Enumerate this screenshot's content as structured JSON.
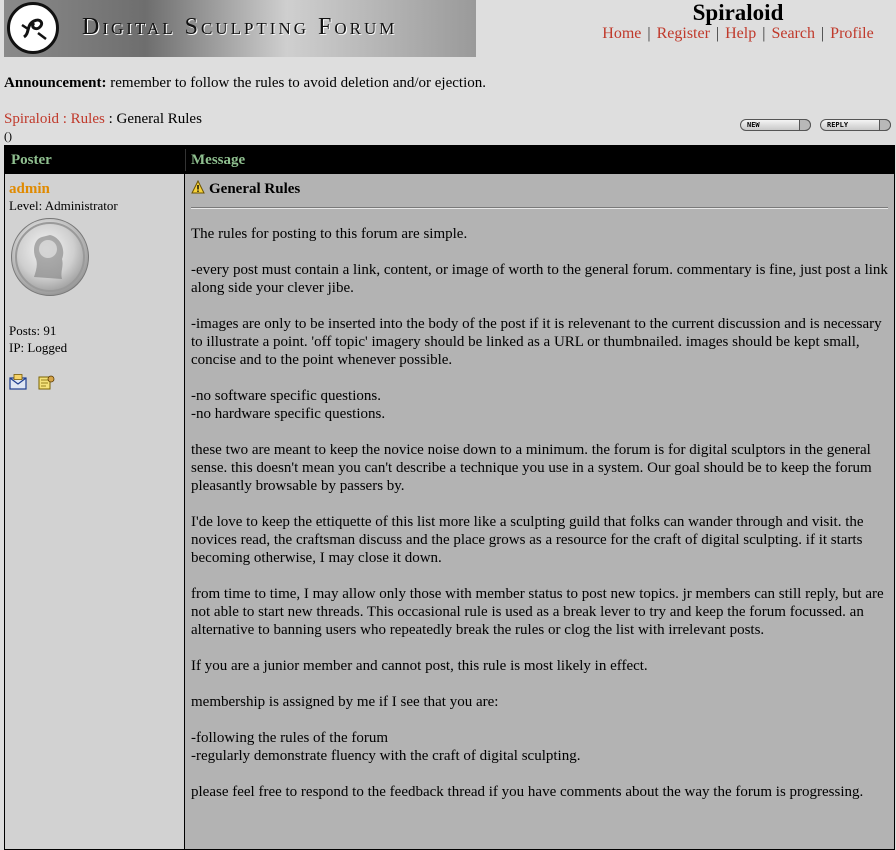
{
  "site": {
    "banner_title": "Digital Sculpting Forum",
    "title": "Spiraloid"
  },
  "nav": {
    "home": "Home",
    "register": "Register",
    "help": "Help",
    "search": "Search",
    "profile": "Profile",
    "separator": "|"
  },
  "announcement": {
    "label": "Announcement:",
    "text": "remember to follow the rules to avoid deletion and/or ejection."
  },
  "breadcrumb": {
    "root": "Spiraloid",
    "sep": ":",
    "forum": "Rules",
    "current": "General Rules"
  },
  "paren": "()",
  "buttons": {
    "new": "NEW",
    "reply": "REPLY"
  },
  "table": {
    "col_poster": "Poster",
    "col_message": "Message"
  },
  "post": {
    "author": "admin",
    "level": "Level: Administrator",
    "posts": "Posts: 91",
    "ip": "IP: Logged",
    "title": "General Rules",
    "paragraphs": [
      "The rules for posting to this forum are simple.",
      "-every post must contain a link, content, or image of worth to the general forum. commentary is fine, just post a link along side your clever jibe.",
      "-images are only to be inserted into the body of the post if it is relevenant to the current discussion and is necessary to illustrate a point. 'off topic' imagery should be linked as a URL or thumbnailed. images should be kept small, concise and to the point whenever possible.",
      "-no software specific questions.",
      "-no hardware specific questions.",
      "these two are meant to keep the novice noise down to a minimum. the forum is for digital sculptors in the general sense. this doesn't mean you can't describe a technique you use in a system. Our goal should be to keep the forum pleasantly browsable by passers by.",
      "I'de love to keep the ettiquette of this list more like a sculpting guild that folks can wander through and visit. the novices read, the craftsman discuss and the place grows as a resource for the craft of digital sculpting. if it starts becoming otherwise, I may close it down.",
      "from time to time, I may allow only those with member status to post new topics. jr members can still reply, but are not able to start new threads. This occasional rule is used as a break lever to try and keep the forum focussed. an alternative to banning users who repeatedly break the rules or clog the list with irrelevant posts.",
      "If you are a junior member and cannot post, this rule is most likely in effect.",
      "membership is assigned by me if I see that you are:",
      "-following the rules of the forum",
      "-regularly demonstrate fluency with the craft of digital sculpting.",
      "please feel free to respond to the feedback thread if you have comments about the way the forum is progressing."
    ]
  },
  "colors": {
    "link": "#c0392b",
    "author": "#e08a00",
    "header_text": "#8fbf8f",
    "header_bg": "#000000",
    "message_bg": "#b3b3b3",
    "poster_bg": "#d2d2d2",
    "page_bg": "#dedede"
  },
  "icons": {
    "logo": "spiral-logo-icon",
    "email": "email-icon",
    "profile": "profile-icon",
    "post": "warning-icon"
  }
}
